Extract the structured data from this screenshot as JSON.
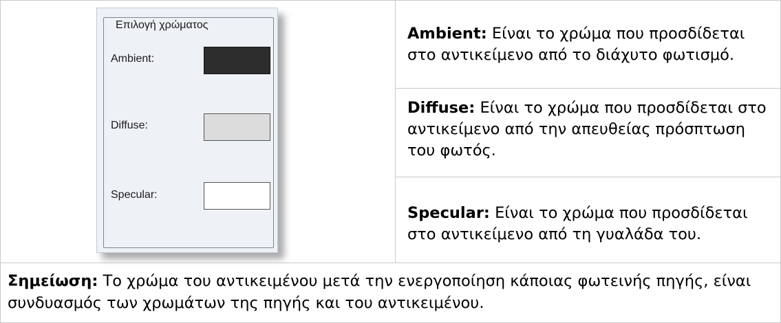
{
  "panel": {
    "group_title": "Επιλογή χρώματος",
    "rows": [
      {
        "label": "Ambient:",
        "color": "#2d2d2d"
      },
      {
        "label": "Diffuse:",
        "color": "#dcdcdc"
      },
      {
        "label": "Specular:",
        "color": "#ffffff"
      }
    ]
  },
  "descriptions": [
    {
      "term": "Ambient:",
      "text": " Είναι το χρώμα που προσδίδεται στο αντικείμενο από το διάχυτο φωτισμό."
    },
    {
      "term": "Diffuse:",
      "text": " Είναι το χρώμα που προσδίδεται στο αντικείμενο από την απευθείας πρόσπτωση του φωτός."
    },
    {
      "term": "Specular:",
      "text": " Είναι το χρώμα που προσδίδεται στο αντικείμενο από τη γυαλάδα του."
    }
  ],
  "note": {
    "term": "Σημείωση:",
    "text": " Το χρώμα του αντικειμένου μετά την ενεργοποίηση κάποιας φωτεινής πηγής, είναι συνδυασμός των χρωμάτων της πηγής και του αντικειμένου."
  }
}
